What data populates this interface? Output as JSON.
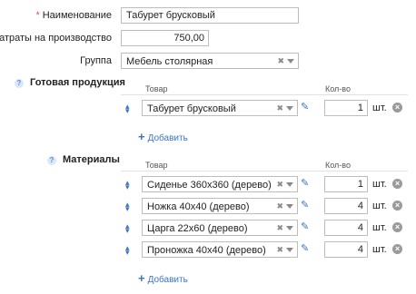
{
  "form": {
    "name_label": "Наименование",
    "name_required_mark": "*",
    "name_value": "Табурет брусковый",
    "cost_label": "Затраты на производство",
    "cost_value": "750,00",
    "group_label": "Группа",
    "group_value": "Мебель столярная"
  },
  "finished": {
    "title": "Готовая продукция",
    "col_product": "Товар",
    "col_qty": "Кол-во",
    "rows": [
      {
        "product": "Табурет брусковый",
        "qty": "1",
        "unit": "шт."
      }
    ],
    "add_label": "Добавить"
  },
  "materials": {
    "title": "Материалы",
    "col_product": "Товар",
    "col_qty": "Кол-во",
    "rows": [
      {
        "product": "Сиденье 360x360 (дерево)",
        "qty": "1",
        "unit": "шт."
      },
      {
        "product": "Ножка 40x40 (дерево)",
        "qty": "4",
        "unit": "шт."
      },
      {
        "product": "Царга 22x60 (дерево)",
        "qty": "4",
        "unit": "шт."
      },
      {
        "product": "Проножка 40x40 (дерево)",
        "qty": "4",
        "unit": "шт."
      }
    ],
    "add_label": "Добавить"
  },
  "icons": {
    "clear": "✖",
    "sort": "sort-arrows-icon",
    "edit": "pencil-icon",
    "delete": "remove-circle-icon",
    "help": "help-icon",
    "add": "plus-icon"
  },
  "colors": {
    "accent": "#3b73c7",
    "required": "#d9534f"
  }
}
